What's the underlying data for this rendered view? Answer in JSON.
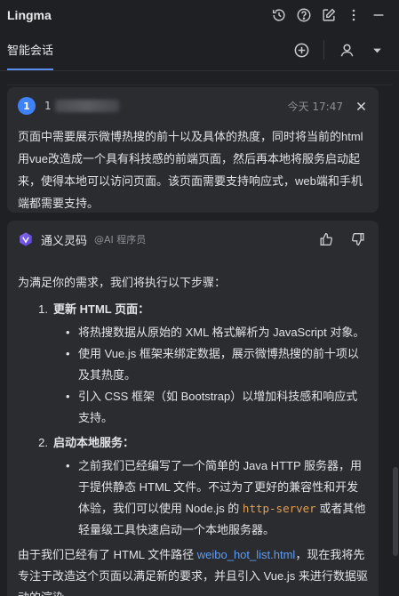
{
  "app": {
    "title": "Lingma"
  },
  "titlebar": {
    "icons": [
      "history-icon",
      "help-icon",
      "edit-icon",
      "more-icon",
      "minimize-icon"
    ]
  },
  "tabbar": {
    "tab_label": "智能会话",
    "actions": [
      "add-icon",
      "user-icon",
      "dropdown-icon"
    ]
  },
  "user_message": {
    "avatar": "1",
    "name": "1",
    "time": "今天 17:47",
    "text": "页面中需要展示微博热搜的前十以及具体的热度，同时将当前的html用vue改造成一个具有科技感的前端页面，然后再本地将服务启动起来，使得本地可以访问页面。该页面需要支持响应式，web端和手机端都需要支持。"
  },
  "ai_message": {
    "name": "通义灵码",
    "tag": "@AI 程序员",
    "intro": "为满足你的需求，我们将执行以下步骤：",
    "steps": [
      {
        "num": "1.",
        "title": "更新 HTML 页面：",
        "bullets": [
          "将热搜数据从原始的 XML 格式解析为 JavaScript 对象。",
          "使用 Vue.js 框架来绑定数据，展示微博热搜的前十项以及其热度。",
          "引入 CSS 框架（如 Bootstrap）以增加科技感和响应式支持。"
        ]
      },
      {
        "num": "2.",
        "title": "启动本地服务：",
        "bullet_prefix": "之前我们已经编写了一个简单的 Java HTTP 服务器，用于提供静态 HTML 文件。不过为了更好的兼容性和开发体验，我们可以使用 Node.js 的 ",
        "bullet_code": "http-server",
        "bullet_suffix": " 或者其他轻量级工具快速启动一个本地服务器。"
      }
    ],
    "outro_prefix": "由于我们已经有了 HTML 文件路径 ",
    "outro_link": "weibo_hot_list.html",
    "outro_suffix": "，现在我将先专注于改造这个页面以满足新的要求，并且引入 Vue.js 来进行数据驱动的渲染。"
  },
  "colors": {
    "background": "#1f2023",
    "card": "#2b2c30",
    "accent": "#5b8def",
    "avatar": "#3f82f5",
    "link": "#5e9cf3",
    "code": "#e0a055"
  }
}
